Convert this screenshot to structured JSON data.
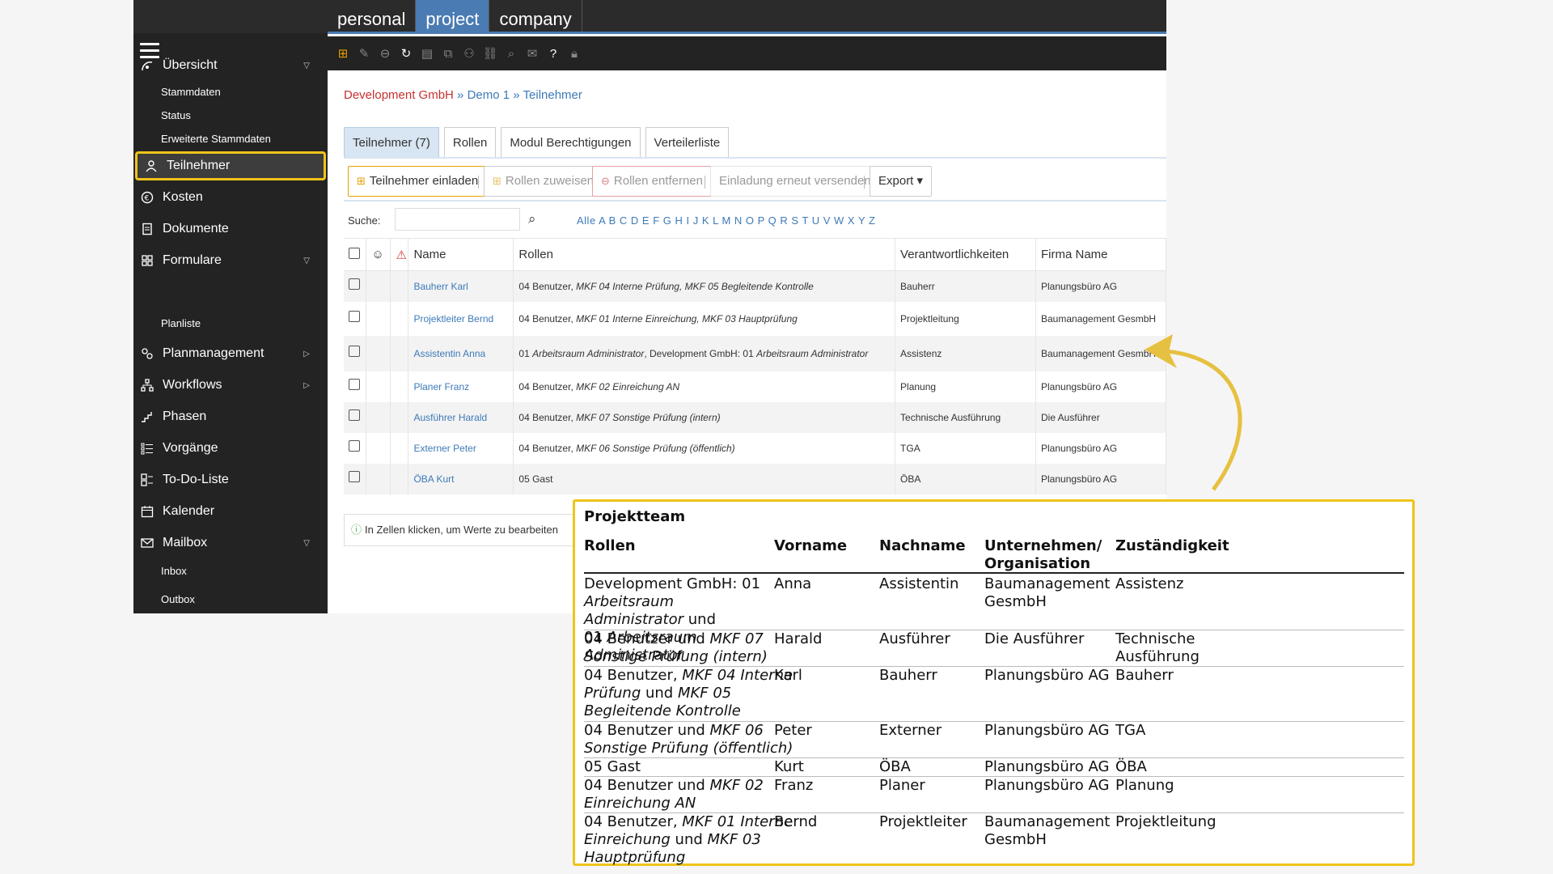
{
  "topbar": {
    "tabs": [
      "personal",
      "project",
      "company"
    ],
    "active": "project"
  },
  "sidebar": {
    "items": [
      {
        "label": "Übersicht",
        "icon": "overview-icon",
        "caret": "▽"
      },
      {
        "label": "Stammdaten",
        "sub": true
      },
      {
        "label": "Status",
        "sub": true
      },
      {
        "label": "Erweiterte Stammdaten",
        "sub": true
      },
      {
        "label": "Teilnehmer",
        "icon": "participants-icon",
        "active": true
      },
      {
        "label": "Kosten",
        "icon": "euro-icon"
      },
      {
        "label": "Dokumente",
        "icon": "documents-icon"
      },
      {
        "label": "Formulare",
        "icon": "forms-icon",
        "caret": "▽"
      },
      {
        "label": "Planliste",
        "sub": true
      },
      {
        "label": "Planmanagement",
        "icon": "plan-icon",
        "caret": "▷"
      },
      {
        "label": "Workflows",
        "icon": "workflow-icon",
        "caret": "▷"
      },
      {
        "label": "Phasen",
        "icon": "phases-icon"
      },
      {
        "label": "Vorgänge",
        "icon": "tasks-icon"
      },
      {
        "label": "To-Do-Liste",
        "icon": "todo-icon"
      },
      {
        "label": "Kalender",
        "icon": "calendar-icon"
      },
      {
        "label": "Mailbox",
        "icon": "mail-icon",
        "caret": "▽"
      },
      {
        "label": "Inbox",
        "sub": true
      },
      {
        "label": "Outbox",
        "sub": true
      }
    ]
  },
  "breadcrumb": {
    "company": "Development GmbH",
    "sep1": " » ",
    "project": "Demo 1",
    "sep2": " » ",
    "page": "Teilnehmer"
  },
  "subtabs": [
    "Teilnehmer (7)",
    "Rollen",
    "Modul Berechtigungen",
    "Verteilerliste"
  ],
  "actions": {
    "invite": "Teilnehmer einladen",
    "assign": "Rollen zuweisen",
    "remove": "Rollen entfernen",
    "resend": "Einladung erneut versenden",
    "export": "Export ▾"
  },
  "search": {
    "label": "Suche:",
    "value": "",
    "alpha": "Alle A B C D E F G H I J K L M N O P Q R S T U V W X Y Z"
  },
  "grid": {
    "headers": {
      "name": "Name",
      "roles": "Rollen",
      "resp": "Verantwortlichkeiten",
      "company": "Firma Name"
    },
    "rows": [
      {
        "name": "Bauherr Karl",
        "roles_plain": "04 Benutzer, ",
        "roles_italic": "MKF 04 Interne Prüfung, MKF 05 Begleitende Kontrolle",
        "resp": "Bauherr",
        "company": "Planungsbüro AG"
      },
      {
        "name": "Projektleiter Bernd",
        "roles_plain": "04 Benutzer, ",
        "roles_italic": "MKF 01 Interne Einreichung, MKF 03 Hauptprüfung",
        "resp": "Projektleitung",
        "company": "Baumanagement GesmbH"
      },
      {
        "name": "Assistentin Anna",
        "roles_plain": "01 ",
        "roles_italic": "Arbeitsraum Administrator",
        "roles_plain2": ", Development GmbH: 01 ",
        "roles_italic2": "Arbeitsraum Administrator",
        "resp": "Assistenz",
        "company": "Baumanagement GesmbH"
      },
      {
        "name": "Planer Franz",
        "roles_plain": "04 Benutzer, ",
        "roles_italic": "MKF 02 Einreichung AN",
        "resp": "Planung",
        "company": "Planungsbüro AG"
      },
      {
        "name": "Ausführer Harald",
        "roles_plain": "04 Benutzer, ",
        "roles_italic": "MKF 07 Sonstige Prüfung (intern)",
        "resp": "Technische Ausführung",
        "company": "Die Ausführer"
      },
      {
        "name": "Externer Peter",
        "roles_plain": "04 Benutzer, ",
        "roles_italic": "MKF 06 Sonstige Prüfung (öffentlich)",
        "resp": "TGA",
        "company": "Planungsbüro AG"
      },
      {
        "name": "ÖBA Kurt",
        "roles_plain": "05 Gast",
        "roles_italic": "",
        "resp": "ÖBA",
        "company": "Planungsbüro AG"
      }
    ]
  },
  "hint": "In Zellen klicken, um Werte zu bearbeiten",
  "card": {
    "title": "Projektteam",
    "headers": {
      "roles": "Rollen",
      "first": "Vorname",
      "last": "Nachname",
      "org_line1": "Unternehmen/",
      "org_line2": "Organisation",
      "resp": "Zuständigkeit"
    },
    "rows": [
      {
        "roles_l1": "Development GmbH: 01",
        "roles_l2_i": "Arbeitsraum Administrator",
        "roles_l2_p": " und",
        "roles_l3_p": "01 ",
        "roles_l3_i": "Arbeitsraum Administrator",
        "first": "Anna",
        "last": "Assistentin",
        "org_l1": "Baumanagement",
        "org_l2": "GesmbH",
        "resp_l1": "Assistenz",
        "resp_l2": ""
      },
      {
        "roles_l1": "04 Benutzer und ",
        "roles_l1_i": "MKF 07",
        "roles_l2_i": "Sonstige Prüfung (intern)",
        "first": "Harald",
        "last": "Ausführer",
        "org_l1": "Die Ausführer",
        "resp_l1": "Technische",
        "resp_l2": "Ausführung"
      },
      {
        "roles_l1": "04 Benutzer, ",
        "roles_l1_i": "MKF 04 Interne",
        "roles_l2_i": "Prüfung",
        "roles_l2_p": " und ",
        "roles_l2_i2": "MKF 05",
        "roles_l3_i": "Begleitende Kontrolle",
        "first": "Karl",
        "last": "Bauherr",
        "org_l1": "Planungsbüro AG",
        "resp_l1": "Bauherr"
      },
      {
        "roles_l1": "04 Benutzer und ",
        "roles_l1_i": "MKF 06",
        "roles_l2_i": "Sonstige Prüfung (öffentlich)",
        "first": "Peter",
        "last": "Externer",
        "org_l1": "Planungsbüro AG",
        "resp_l1": "TGA"
      },
      {
        "roles_l1": "05 Gast",
        "first": "Kurt",
        "last": "ÖBA",
        "org_l1": "Planungsbüro AG",
        "resp_l1": "ÖBA"
      },
      {
        "roles_l1": "04 Benutzer und ",
        "roles_l1_i": "MKF 02",
        "roles_l2_i": "Einreichung AN",
        "first": "Franz",
        "last": "Planer",
        "org_l1": "Planungsbüro AG",
        "resp_l1": "Planung"
      },
      {
        "roles_l1": "04 Benutzer, ",
        "roles_l1_i": "MKF 01 Interne",
        "roles_l2_i": "Einreichung",
        "roles_l2_p": " und ",
        "roles_l2_i2": "MKF 03",
        "roles_l3_i": "Hauptprüfung",
        "first": "Bernd",
        "last": "Projektleiter",
        "org_l1": "Baumanagement",
        "org_l2": "GesmbH",
        "resp_l1": "Projektleitung"
      }
    ]
  },
  "colors": {
    "accent": "#f0c419",
    "blue": "#4a7bb3",
    "link": "#3d7ab8",
    "breadcrumb_company": "#c83030"
  }
}
